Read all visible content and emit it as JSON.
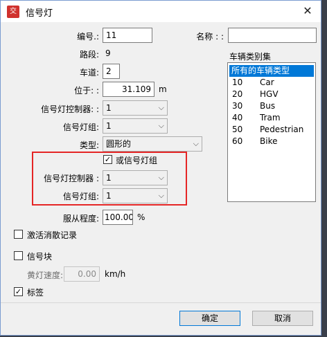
{
  "window": {
    "title": "信号灯",
    "app_icon_text": "交"
  },
  "form": {
    "id_label": "编号.:",
    "id_value": "11",
    "name_label": "名称 : :",
    "name_value": "",
    "link_label": "路段:",
    "link_value": "9",
    "lane_label": "车道:",
    "lane_value": "2",
    "position_label": "位于: :",
    "position_value": "31.109",
    "position_unit": "m",
    "controller_label": "信号灯控制器: :",
    "controller_value": "1",
    "group_label": "信号灯组:",
    "group_value": "1",
    "type_label": "类型:",
    "type_value": "圆形的",
    "or_group_label": "或信号灯组",
    "or_group_checked": true,
    "or_controller_label": "信号灯控制器  :",
    "or_controller_value": "1",
    "or_group2_label": "信号灯组:",
    "or_group2_value": "1",
    "compliance_label": "服从程度:",
    "compliance_value": "100.00",
    "compliance_unit": "%",
    "activate_label": "激活消散记录",
    "activate_checked": false,
    "signal_block_label": "信号块",
    "signal_block_checked": false,
    "amber_speed_label": "黄灯速度:",
    "amber_speed_value": "0.00",
    "amber_speed_unit": "km/h",
    "label_label": "标签",
    "label_checked": true
  },
  "vehicle_classes": {
    "title": "车辆类别集",
    "items": [
      {
        "num": "",
        "name": "所有的车辆类型",
        "selected": true
      },
      {
        "num": "10",
        "name": "Car"
      },
      {
        "num": "20",
        "name": "HGV"
      },
      {
        "num": "30",
        "name": "Bus"
      },
      {
        "num": "40",
        "name": "Tram"
      },
      {
        "num": "50",
        "name": "Pedestrian"
      },
      {
        "num": "60",
        "name": "Bike"
      }
    ]
  },
  "buttons": {
    "ok": "确定",
    "cancel": "取消"
  },
  "colors": {
    "highlight_box": "#e52525",
    "selection": "#0078d7"
  }
}
